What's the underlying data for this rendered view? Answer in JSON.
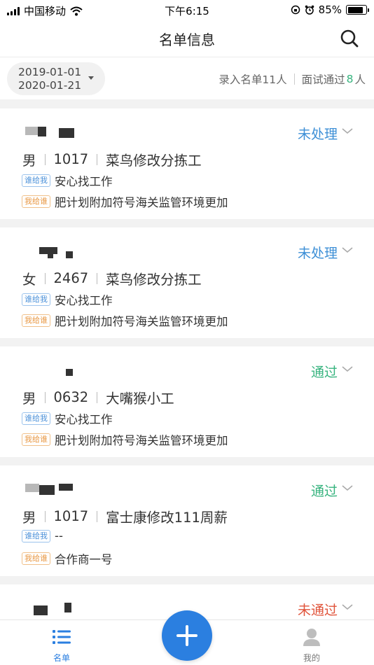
{
  "status_bar": {
    "carrier": "中国移动",
    "time": "下午6:15",
    "battery": "85%",
    "battery_level": 0.85
  },
  "nav": {
    "title": "名单信息",
    "search_icon": "search-icon"
  },
  "filter": {
    "date_start": "2019-01-01",
    "date_end": "2020-01-21",
    "entered_label": "录入名单11人",
    "passed_label": "面试通过",
    "passed_count": "8",
    "passed_unit": "人"
  },
  "cards": [
    {
      "status": "未处理",
      "gender": "男",
      "code": "1017",
      "job": "菜鸟修改分拣工",
      "tag1": "谁给我",
      "value1": "安心找工作",
      "tag2": "我给谁",
      "value2": "肥计划附加符号海关监管环境更加"
    },
    {
      "status": "未处理",
      "gender": "女",
      "code": "2467",
      "job": "菜鸟修改分拣工",
      "tag1": "谁给我",
      "value1": "安心找工作",
      "tag2": "我给谁",
      "value2": "肥计划附加符号海关监管环境更加"
    },
    {
      "status": "通过",
      "gender": "男",
      "code": "0632",
      "job": "大嘴猴小工",
      "tag1": "谁给我",
      "value1": "安心找工作",
      "tag2": "我给谁",
      "value2": "肥计划附加符号海关监管环境更加"
    },
    {
      "status": "通过",
      "gender": "男",
      "code": "1017",
      "job": "富士康修改111周薪",
      "tag1": "谁给我",
      "value1": "--",
      "tag2": "我给谁",
      "value2": "合作商一号"
    },
    {
      "status": "未通过"
    }
  ],
  "tab_bar": {
    "tab_list": "名单",
    "tab_me": "我的"
  },
  "colors": {
    "accent": "#2b7fe0",
    "pending": "#3d8fd6",
    "passed": "#36b37e",
    "failed": "#e0533a"
  }
}
